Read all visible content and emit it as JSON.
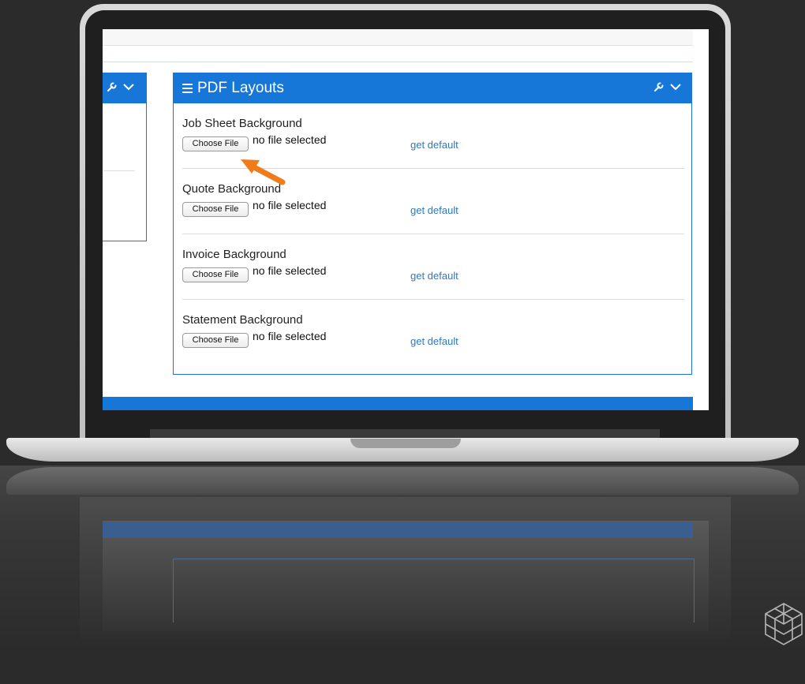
{
  "panel": {
    "title": "PDF Layouts",
    "rows": [
      {
        "label": "Job Sheet Background",
        "button": "Choose File",
        "status": "no file selected",
        "link": "get default"
      },
      {
        "label": "Quote Background",
        "button": "Choose File",
        "status": "no file selected",
        "link": "get default"
      },
      {
        "label": "Invoice Background",
        "button": "Choose File",
        "status": "no file selected",
        "link": "get default"
      },
      {
        "label": "Statement Background",
        "button": "Choose File",
        "status": "no file selected",
        "link": "get default"
      }
    ]
  },
  "icons": {
    "menu": "hamburger-icon",
    "tools": "wrench-icon",
    "collapse": "chevron-down-icon",
    "pointer": "arrow-pointer-icon",
    "logo": "hex-cube-logo"
  },
  "colors": {
    "header_blue": "#1677d9",
    "link_blue": "#2a7ac3",
    "arrow_orange": "#f07c19",
    "background": "#2b2b2b"
  }
}
